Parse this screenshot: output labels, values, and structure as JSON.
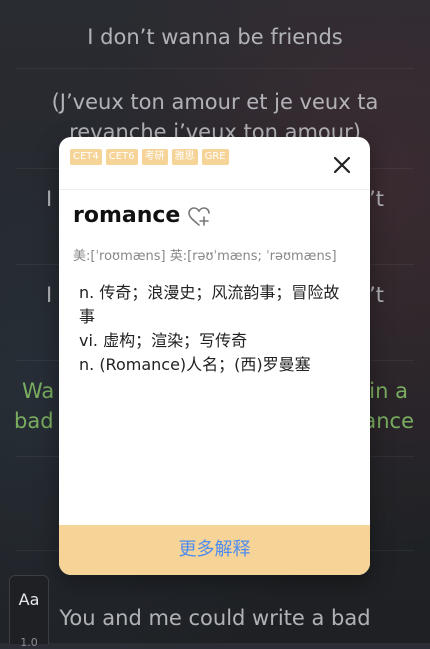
{
  "lyrics": {
    "line1": "I don’t wanna be friends",
    "line2a": "(J’veux ton amour et je veux ta",
    "line2b": "revanche j’veux ton amour)",
    "line3_left": "I",
    "line3_right": "’t",
    "line4_left": "I",
    "line4_right": "’t",
    "line5a_left": "Wa",
    "line5a_right": "in a",
    "line5b_left": "bad",
    "line5b_right": "ance",
    "line6": "You and me could write a bad"
  },
  "dictionary": {
    "tags": [
      "CET4",
      "CET6",
      "考研",
      "雅思",
      "GRE"
    ],
    "word": "romance",
    "phonetic": "美:[ˈroʊmæns]   英:[rəʊˈmæns; ˈrəʊmæns]",
    "definitions": [
      "n. 传奇；浪漫史；风流韵事；冒险故事",
      "vi. 虚构；渲染；写传奇",
      "n. (Romance)人名；(西)罗曼塞"
    ],
    "more_label": "更多解释"
  },
  "font_control": {
    "label": "Aa",
    "value": "1.0"
  },
  "colors": {
    "tag_bg": "#f6d396",
    "accent_blue": "#4f8cf0",
    "highlight_green": "#9ee27a"
  },
  "icons": {
    "close": "close-icon",
    "favorite": "heart-plus-icon"
  }
}
